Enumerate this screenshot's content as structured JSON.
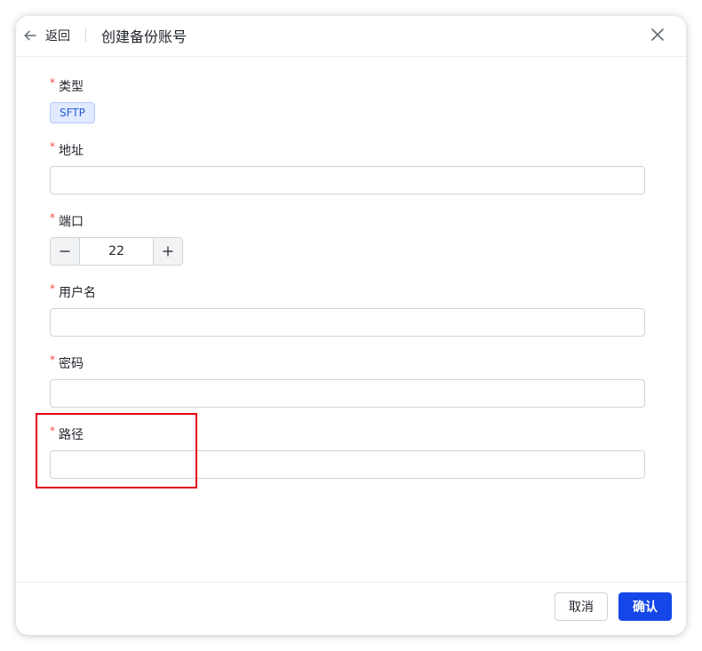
{
  "header": {
    "back_label": "返回",
    "title": "创建备份账号"
  },
  "form": {
    "type": {
      "label": "类型",
      "value": "SFTP"
    },
    "address": {
      "label": "地址",
      "value": ""
    },
    "port": {
      "label": "端口",
      "value": "22"
    },
    "username": {
      "label": "用户名",
      "value": ""
    },
    "password": {
      "label": "密码",
      "value": ""
    },
    "path": {
      "label": "路径",
      "value": ""
    },
    "required_mark": "*"
  },
  "footer": {
    "cancel_label": "取消",
    "confirm_label": "确认"
  },
  "colors": {
    "primary": "#1547e8",
    "required": "#f54a45",
    "highlight": "#e60012",
    "tag_bg": "#e1eaff"
  },
  "icons": {
    "back": "arrow-left-icon",
    "close": "close-icon",
    "minus": "minus-icon",
    "plus": "plus-icon"
  }
}
